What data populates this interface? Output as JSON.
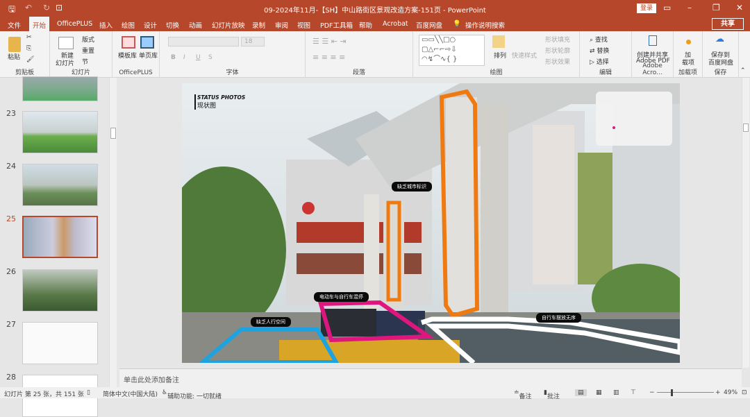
{
  "app": {
    "title": "09-2024年11月-【SH】中山路街区景观改造方案-151页  -  PowerPoint",
    "login": "登录",
    "share": "共享"
  },
  "tabs": [
    "文件",
    "开始",
    "OfficePLUS",
    "插入",
    "绘图",
    "设计",
    "切换",
    "动画",
    "幻灯片放映",
    "录制",
    "审阅",
    "视图",
    "PDF工具箱",
    "帮助",
    "Acrobat",
    "百度网盘",
    "操作说明搜索"
  ],
  "ribbon": {
    "clipboard": {
      "paste": "粘贴",
      "label": "剪贴板"
    },
    "slides": {
      "new": "新建",
      "new2": "幻灯片",
      "layout": "版式",
      "reset": "重置",
      "section": "节",
      "label": "幻灯片"
    },
    "officeplus": {
      "template": "模板库",
      "single": "单页库",
      "label": "OfficePLUS"
    },
    "font": {
      "size": "18",
      "label": "字体",
      "b": "B",
      "i": "I",
      "u": "U",
      "s": "S"
    },
    "paragraph": {
      "label": "段落"
    },
    "drawing": {
      "arrange": "排列",
      "quickstyle": "快速样式",
      "fill": "形状填充",
      "outline": "形状轮廓",
      "effect": "形状效果",
      "label": "绘图"
    },
    "editing": {
      "find": "查找",
      "replace": "替换",
      "select": "选择",
      "label": "编辑"
    },
    "adobe": {
      "create": "创建并共享",
      "pdf": "Adobe PDF",
      "label": "Adobe Acro..."
    },
    "addins": {
      "a": "加",
      "b": "载项",
      "label": "加载项"
    },
    "save": {
      "a": "保存到",
      "b": "百度网盘",
      "label": "保存"
    }
  },
  "thumbnails": [
    {
      "num": "23"
    },
    {
      "num": "24"
    },
    {
      "num": "25",
      "selected": true
    },
    {
      "num": "26"
    },
    {
      "num": "27"
    },
    {
      "num": "28"
    }
  ],
  "slide": {
    "heading": "STATUS PHOTOS",
    "subheading": "现状图",
    "callouts": [
      "缺乏城市标识",
      "电动车与自行车混停",
      "缺乏人行空间",
      "自行车摆放无序"
    ],
    "colors": {
      "orange": "#f07a12",
      "magenta": "#e0167f",
      "blue": "#1ea3e0",
      "white": "#ffffff"
    }
  },
  "notes": {
    "placeholder": "单击此处添加备注"
  },
  "status": {
    "slide": "幻灯片 第 25 张，共 151 张",
    "lang": "简体中文(中国大陆)",
    "access": "辅助功能: 一切就绪",
    "notes": "备注",
    "comments": "批注",
    "zoom": "49%"
  }
}
